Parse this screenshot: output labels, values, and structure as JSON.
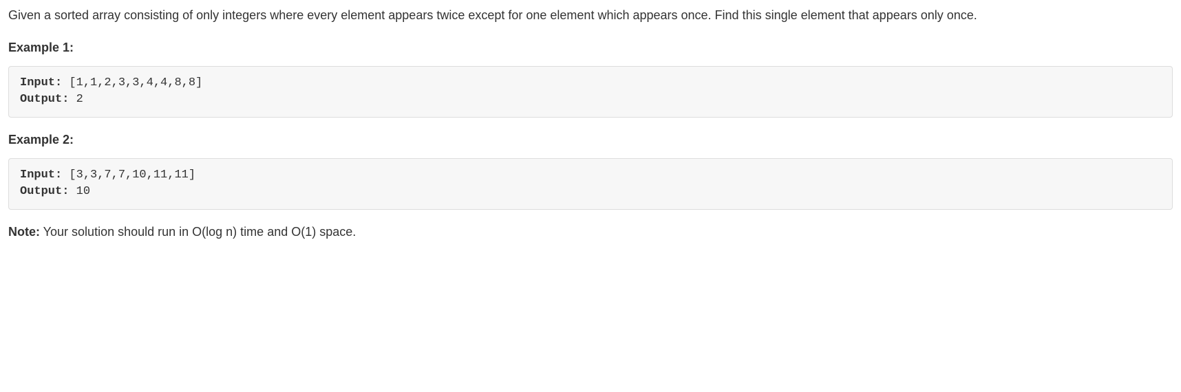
{
  "problem": {
    "description": "Given a sorted array consisting of only integers where every element appears twice except for one element which appears once. Find this single element that appears only once."
  },
  "example1": {
    "heading": "Example 1:",
    "input_label": "Input:",
    "input_value": " [1,1,2,3,3,4,4,8,8]",
    "output_label": "Output:",
    "output_value": " 2"
  },
  "example2": {
    "heading": "Example 2:",
    "input_label": "Input:",
    "input_value": " [3,3,7,7,10,11,11]",
    "output_label": "Output:",
    "output_value": " 10"
  },
  "note": {
    "label": "Note:",
    "text": " Your solution should run in O(log n) time and O(1) space."
  }
}
